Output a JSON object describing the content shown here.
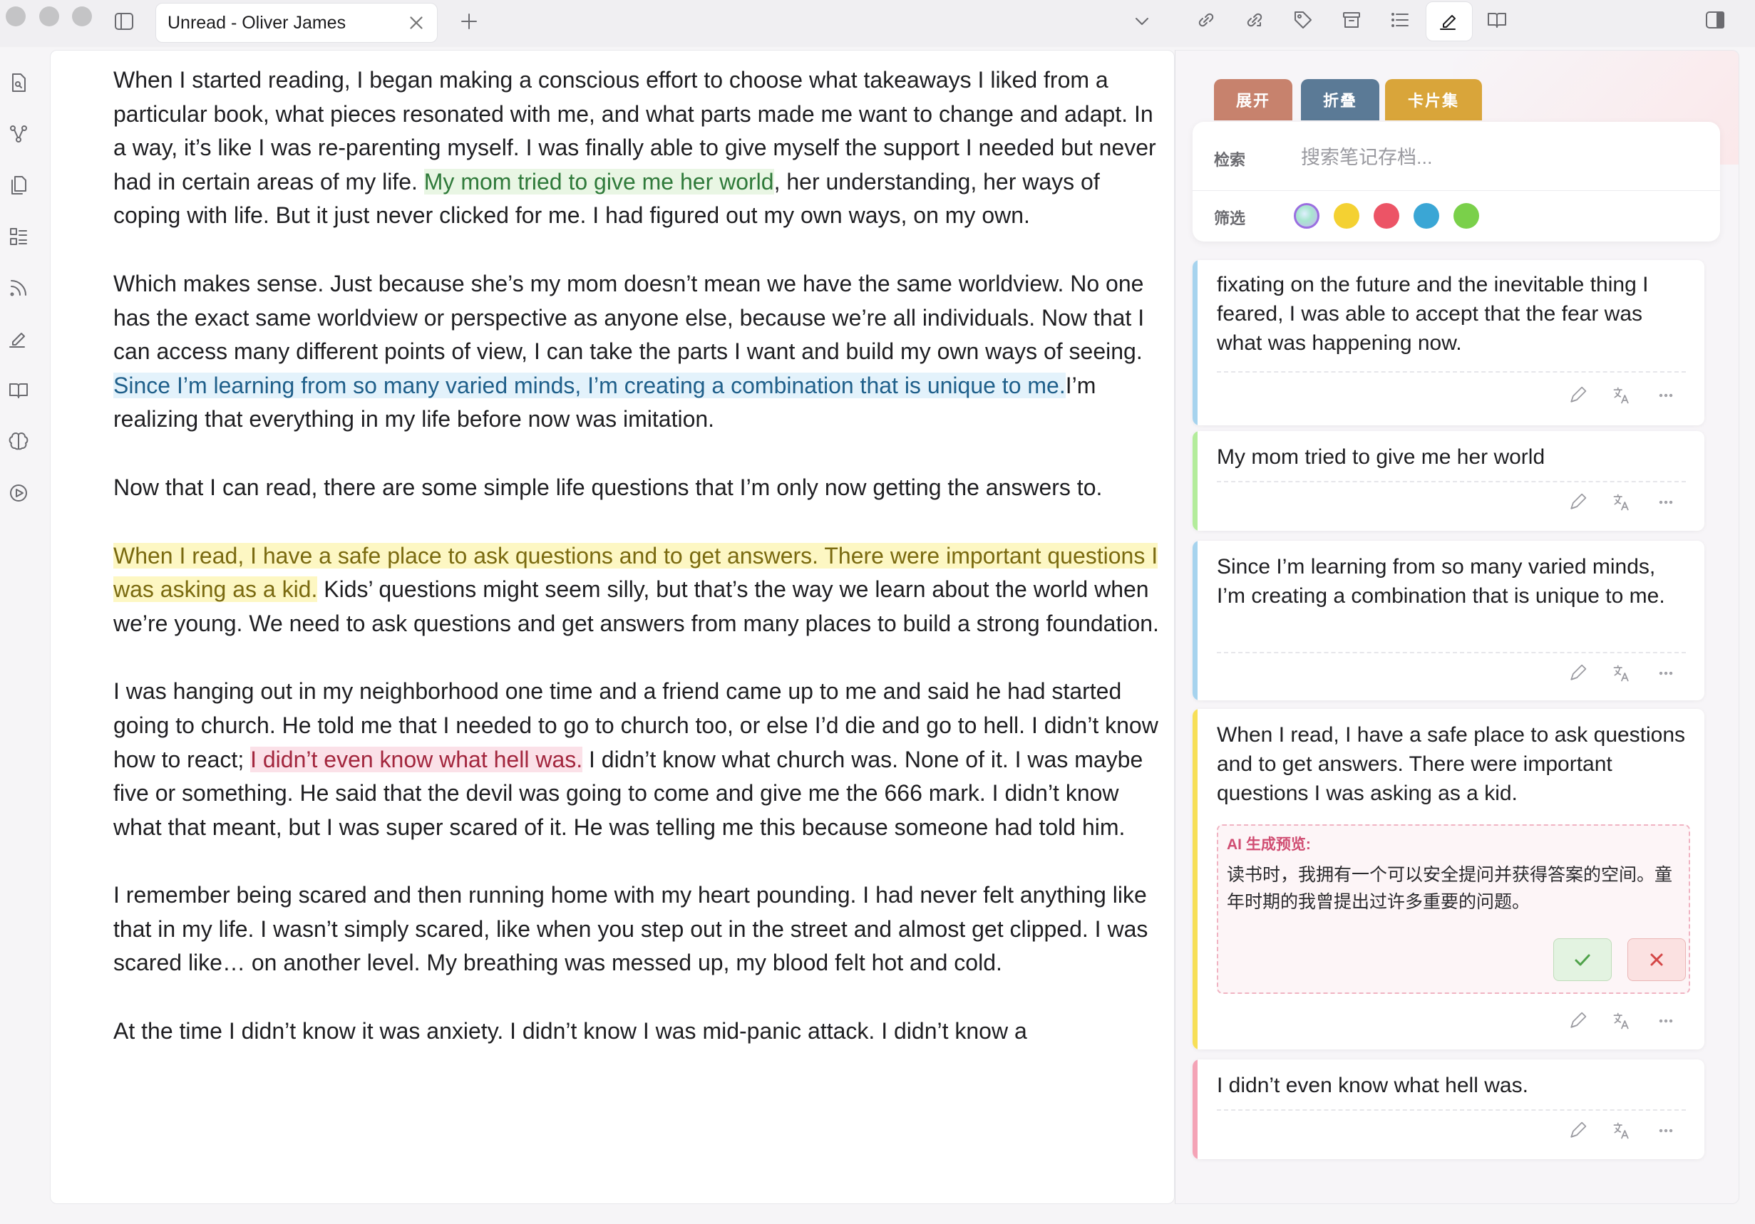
{
  "tab": {
    "title": "Unread - Oliver James"
  },
  "reading": {
    "p1_a": "When I started reading, I began making a conscious effort to choose what takeaways I liked from a particular book, what pieces resonated with me, and what parts made me want to change and adapt. In a way, it’s like I was re-parenting myself. I was finally able to give myself the support I needed but never had in certain areas of my life. ",
    "p1_hl": "My mom tried to give me her world",
    "p1_b": ", her understanding, her ways of coping with life. But it just never clicked for me. I had figured out my own ways, on my own.",
    "p2_a": "Which makes sense. Just because she’s my mom doesn’t mean we have the same worldview. No one has the exact same worldview or perspective as anyone else, because we’re all individuals. Now that I can access many different points of view, I can take the parts I want and build my own ways of seeing. ",
    "p2_hl": "Since I’m learning from so many varied minds, I’m creating a combination that is unique to me.",
    "p2_b": "I’m realizing that everything in my life before now was imitation.",
    "p3": "Now that I can read, there are some simple life questions that I’m only now getting the answers to.",
    "p4_hl": "When I read, I have a safe place to ask questions and to get answers. There were important questions I was asking as a kid.",
    "p4_b": " Kids’ questions might seem silly, but that’s the way we learn about the world when we’re young. We need to ask questions and get answers from many places to build a strong foundation.",
    "p5_a": "I was hanging out in my neighborhood one time and a friend came up to me and said he had started going to church. He told me that I needed to go to church too, or else I’d die and go to hell. I didn’t know how to react; ",
    "p5_hl": "I didn’t even know what hell was.",
    "p5_b": " I didn’t know what church was. None of it. I was maybe five or something. He said that the devil was going to come and give me the 666 mark. I didn’t know what that meant, but I was super scared of it. He was telling me this because someone had told him.",
    "p6": "I remember being scared and then running home with my heart pounding. I had never felt anything like that in my life. I wasn’t simply scared, like when you step out in the street and almost get clipped. I was scared like… on another level. My breathing was messed up, my blood felt hot and cold.",
    "p7": "At the time I didn’t know it was anxiety. I didn’t know I was mid-panic attack. I didn’t know a"
  },
  "panel": {
    "tabs": {
      "expand": "展开",
      "collapse": "折叠",
      "cards": "卡片集"
    },
    "search_label": "检索",
    "search_placeholder": "搜索笔记存档...",
    "filter_label": "筛选",
    "filter_colors": [
      "#f4d132",
      "#ec5466",
      "#3aa6d5",
      "#7ad04a"
    ]
  },
  "cards": [
    {
      "text": "fixating on the future and the inevitable thing I feared, I was able to accept that the fear was what was happening now.",
      "color": "#a6d3ee"
    },
    {
      "text": "My mom tried to give me her world",
      "color": "#b3ec9b"
    },
    {
      "text": "Since I’m learning from so many varied minds, I’m creating a combination that is unique to me.",
      "color": "#a6d3ee"
    },
    {
      "text": "When I read, I have a safe place to ask questions and to get answers. There were important questions I was asking as a kid.",
      "color": "#f7df57"
    },
    {
      "text": "I didn’t even know what hell was.",
      "color": "#f4a3b6"
    }
  ],
  "ai_preview": {
    "title": "AI 生成预览:",
    "text": "读书时，我拥有一个可以安全提问并获得答案的空间。童年时期的我曾提出过许多重要的问题。"
  }
}
